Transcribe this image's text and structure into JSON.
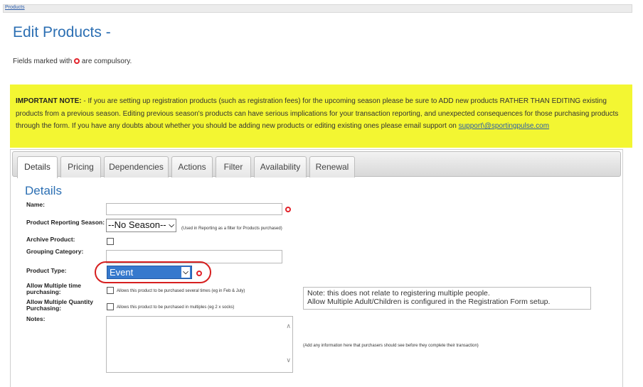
{
  "breadcrumb": {
    "label": "Products"
  },
  "page": {
    "title": "Edit Products -"
  },
  "compulsory_note": {
    "before": "Fields marked with",
    "after": "are compulsory."
  },
  "important": {
    "lead": "IMPORTANT NOTE:",
    "text": " - If you are setting up registration products (such as registration fees) for the upcoming season please be sure to ADD new products RATHER THAN EDITING existing products from a previous season. Editing previous season's products can have serious implications for your transaction reporting, and unexpected consequences for those purchasing products through the form. If you have any doubts about whether you should be adding new products or editing existing ones please email support on ",
    "email_link": "support\\@sportingpulse.com"
  },
  "tabs": [
    {
      "label": "Details"
    },
    {
      "label": "Pricing"
    },
    {
      "label": "Dependencies"
    },
    {
      "label": "Actions"
    },
    {
      "label": "Filter"
    },
    {
      "label": "Availability"
    },
    {
      "label": "Renewal"
    }
  ],
  "details": {
    "section_title": "Details",
    "name_label": "Name:",
    "name_value": "",
    "season_label": "Product Reporting Season:",
    "season_value": "--No Season--",
    "season_hint": "(Used in Reporting as a filter for Products purchased)",
    "archive_label": "Archive Product:",
    "grouping_label": "Grouping Category:",
    "grouping_value": "",
    "type_label": "Product Type:",
    "type_value": "Event",
    "multi_time_label_1": "Allow Multiple time",
    "multi_time_label_2": "purchasing:",
    "multi_time_hint": "Allows this product to be purchased several times (eg in Feb & July)",
    "multi_qty_label_1": "Allow Multiple Quantity",
    "multi_qty_label_2": "Purchasing:",
    "multi_qty_hint": "Allows this product to be purchased in multiples (eg 2 x socks)",
    "info_line_1": "Note: this does not relate to registering multiple people.",
    "info_line_2": "Allow Multiple Adult/Children is configured in the Registration Form setup.",
    "notes_label": "Notes:",
    "notes_value": "",
    "notes_hint": "(Add any information here that purchasers should see before they complete their transaction)"
  },
  "colors": {
    "accent": "#2c6fb3",
    "required": "#e2222a",
    "warning_bg": "#f3f632",
    "highlight": "#d61f1f"
  }
}
